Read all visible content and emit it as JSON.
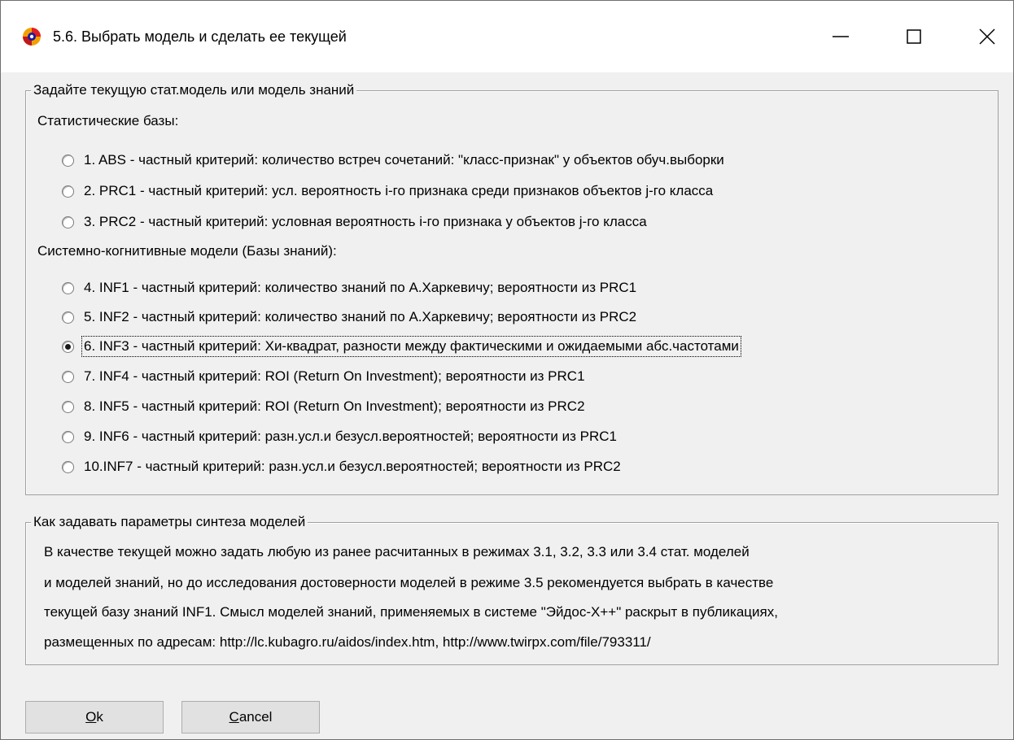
{
  "window": {
    "title": "5.6. Выбрать модель и сделать ее текущей",
    "controls": {
      "minimize": "minimize-icon",
      "maximize": "maximize-icon",
      "close": "close-icon"
    }
  },
  "model_group": {
    "legend": "Задайте текущую стат.модель или модель знаний",
    "stat_label": "Статистические базы:",
    "knowledge_label": "Системно-когнитивные модели (Базы знаний):",
    "selected_index": 5,
    "options": [
      {
        "label": "1. ABS  - частный критерий: количество встреч сочетаний: \"класс-признак\" у объектов обуч.выборки",
        "checked": false
      },
      {
        "label": "2. PRC1 - частный критерий: усл. вероятность i-го признака среди признаков объектов j-го класса",
        "checked": false
      },
      {
        "label": "3. PRC2 - частный критерий: условная вероятность i-го признака у объектов j-го класса",
        "checked": false
      },
      {
        "label": "4. INF1 - частный критерий: количество знаний по А.Харкевичу; вероятности из PRC1",
        "checked": false
      },
      {
        "label": "5. INF2 - частный критерий: количество знаний по А.Харкевичу; вероятности из PRC2",
        "checked": false
      },
      {
        "label": "6. INF3 - частный критерий: Хи-квадрат, разности между фактическими и ожидаемыми абс.частотами",
        "checked": true
      },
      {
        "label": "7. INF4 - частный критерий: ROI (Return On Investment); вероятности из PRC1",
        "checked": false
      },
      {
        "label": "8. INF5 - частный критерий: ROI (Return On Investment); вероятности из PRC2",
        "checked": false
      },
      {
        "label": "9. INF6 - частный критерий: разн.усл.и безусл.вероятностей; вероятности из PRC1",
        "checked": false
      },
      {
        "label": "10.INF7 - частный критерий: разн.усл.и безусл.вероятностей; вероятности из PRC2",
        "checked": false
      }
    ]
  },
  "help_group": {
    "legend": "Как задавать параметры синтеза моделей",
    "lines": [
      "В качестве текущей можно задать любую из ранее расчитанных в режимах 3.1, 3.2, 3.3 или 3.4 стат. моделей",
      "и моделей знаний, но до исследования достоверности моделей в режиме 3.5 рекомендуется выбрать в качестве",
      "текущей базу знаний INF1. Смысл моделей знаний, применяемых в системе \"Эйдос-Х++\" раскрыт в публикациях,",
      "размещенных по адресам: http://lc.kubagro.ru/aidos/index.htm, http://www.twirpx.com/file/793311/"
    ]
  },
  "buttons": {
    "ok": {
      "accel": "O",
      "rest": "k"
    },
    "cancel": {
      "accel": "C",
      "rest": "ancel"
    }
  }
}
